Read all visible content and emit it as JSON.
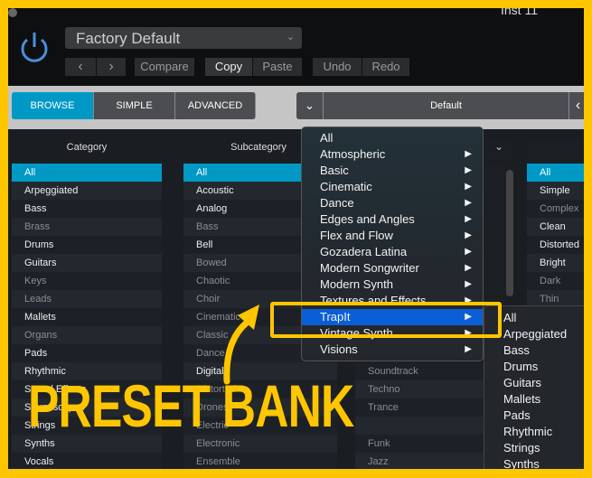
{
  "header": {
    "instrument": "Inst 11",
    "preset": "Factory Default",
    "buttons": {
      "prev": "‹",
      "next": "›",
      "compare": "Compare",
      "copy": "Copy",
      "paste": "Paste",
      "undo": "Undo",
      "redo": "Redo"
    }
  },
  "tabs": {
    "browse": "BROWSE",
    "simple": "SIMPLE",
    "advanced": "ADVANCED",
    "bank": "Default",
    "chevron": "⌄",
    "back": "‹"
  },
  "columns": {
    "category": "Category",
    "subcategory": "Subcategory"
  },
  "category": [
    "All",
    "Arpeggiated",
    "Bass",
    "Brass",
    "Drums",
    "Guitars",
    "Keys",
    "Leads",
    "Mallets",
    "Organs",
    "Pads",
    "Rhythmic",
    "Sound Effects",
    "Soundscapes",
    "Strings",
    "Synths",
    "Vocals"
  ],
  "subcategory": [
    "All",
    "Acoustic",
    "Analog",
    "Bass",
    "Bell",
    "Bowed",
    "Chaotic",
    "Choir",
    "Cinematic",
    "Classic",
    "Dance",
    "Digital",
    "Distorted",
    "Drones",
    "Electric",
    "Electronic",
    "Ensemble"
  ],
  "genre": [
    "Soundtrack",
    "Techno",
    "Trance",
    "",
    "Funk",
    "Jazz"
  ],
  "attribute": [
    "All",
    "Simple",
    "Complex",
    "Clean",
    "Distorted",
    "Bright",
    "Dark",
    "Thin"
  ],
  "menu": [
    "All",
    "Atmospheric",
    "Basic",
    "Cinematic",
    "Dance",
    "Edges and Angles",
    "Flex and Flow",
    "Gozadera Latina",
    "Modern Songwriter",
    "Modern Synth",
    "Textures and Effects",
    "TrapIt",
    "Vintage Synth",
    "Visions"
  ],
  "submenu": [
    "All",
    "Arpeggiated",
    "Bass",
    "Drums",
    "Guitars",
    "Mallets",
    "Pads",
    "Rhythmic",
    "Strings",
    "Synths"
  ],
  "overlay": {
    "title": "PRESET BANK"
  },
  "colors": {
    "accent": "#0099c6",
    "highlight": "#0a5fd6",
    "annotation": "#ffc600"
  }
}
